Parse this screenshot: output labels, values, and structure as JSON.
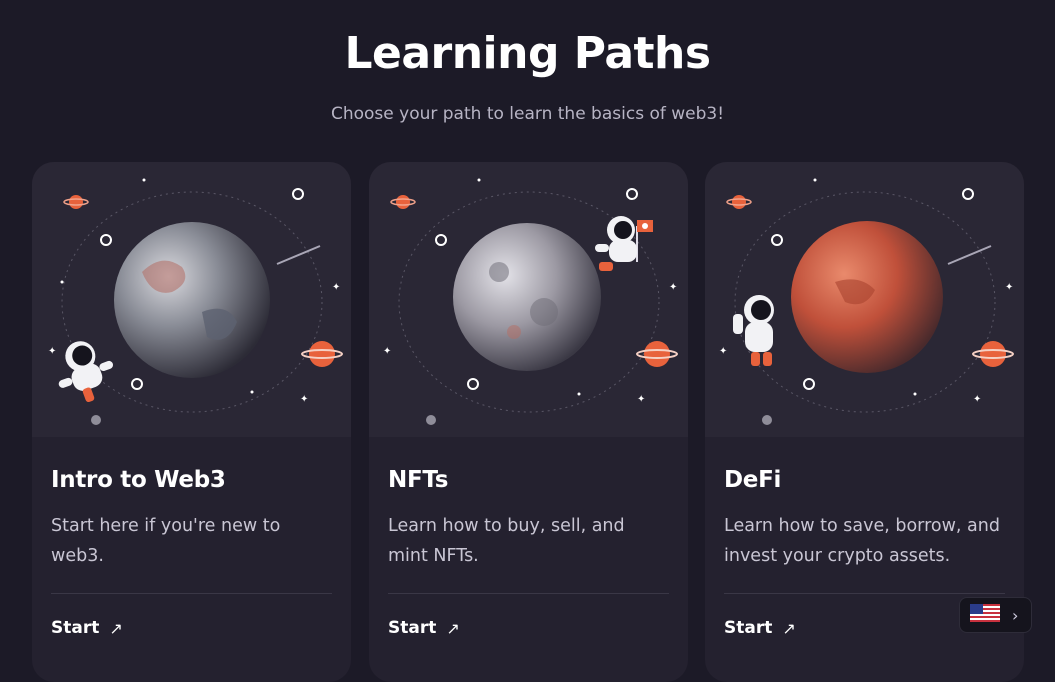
{
  "page": {
    "title": "Learning Paths",
    "subtitle": "Choose your path to learn the basics of web3!"
  },
  "cards": [
    {
      "title": "Intro to Web3",
      "description": "Start here if you're new to web3.",
      "link_label": "Start",
      "link_icon": "arrow-up-right-icon",
      "illustration": "earth-astronaut-illustration"
    },
    {
      "title": "NFTs",
      "description": "Learn how to buy, sell, and mint NFTs.",
      "link_label": "Start",
      "link_icon": "arrow-up-right-icon",
      "illustration": "moon-astronaut-flag-illustration"
    },
    {
      "title": "DeFi",
      "description": "Learn how to save, borrow, and invest your crypto assets.",
      "link_label": "Start",
      "link_icon": "arrow-up-right-icon",
      "illustration": "mars-astronaut-illustration"
    }
  ],
  "language_selector": {
    "flag_icon": "us-flag-icon",
    "chevron_icon": "chevron-right-icon"
  },
  "colors": {
    "background": "#1c1a27",
    "card": "#24212f",
    "accent_orange": "#e8623c",
    "text_muted": "#b7b4c4"
  }
}
